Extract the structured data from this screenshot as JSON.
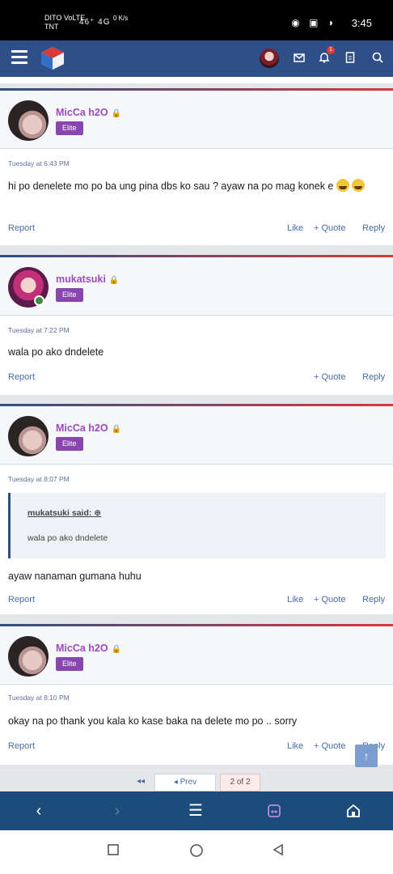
{
  "status": {
    "carrier1": "DITO VoLTE",
    "carrier2": "TNT",
    "signal": "46⁺ 4G",
    "speed": "0 K/s",
    "icons": "◉ ▣ ◑",
    "battery": "40",
    "time": "3:45"
  },
  "appbar": {
    "menu_icon": "menu-icon",
    "notification_count": "1"
  },
  "posts": [
    {
      "user": "MicCa h2O",
      "badge": "Elite",
      "date": "Tuesday at 6:43 PM",
      "message": "hi po denelete mo po ba ung pina dbs ko sau ? ayaw na po mag konek e",
      "report": "Report",
      "like": "Like",
      "quote": "+ Quote",
      "reply": "Reply"
    },
    {
      "user": "mukatsuki",
      "badge": "Elite",
      "date": "Tuesday at 7:22 PM",
      "message": "wala po ako dndelete",
      "report": "Report",
      "quote": "+ Quote",
      "reply": "Reply"
    },
    {
      "user": "MicCa h2O",
      "badge": "Elite",
      "date": "Tuesday at 8:07 PM",
      "quote_author": "mukatsuki said:",
      "quote_text": "wala po ako dndelete",
      "message": "ayaw nanaman gumana huhu",
      "report": "Report",
      "like": "Like",
      "quote": "+ Quote",
      "reply": "Reply"
    },
    {
      "user": "MicCa h2O",
      "badge": "Elite",
      "date": "Tuesday at 8:10 PM",
      "message": "okay na po thank you kala ko kase baka na delete mo po .. sorry",
      "report": "Report",
      "like": "Like",
      "quote": "+ Quote",
      "reply": "Reply"
    }
  ],
  "pagination": {
    "prev": "◂ Prev",
    "current": "2 of 2",
    "first": "◂◂"
  }
}
